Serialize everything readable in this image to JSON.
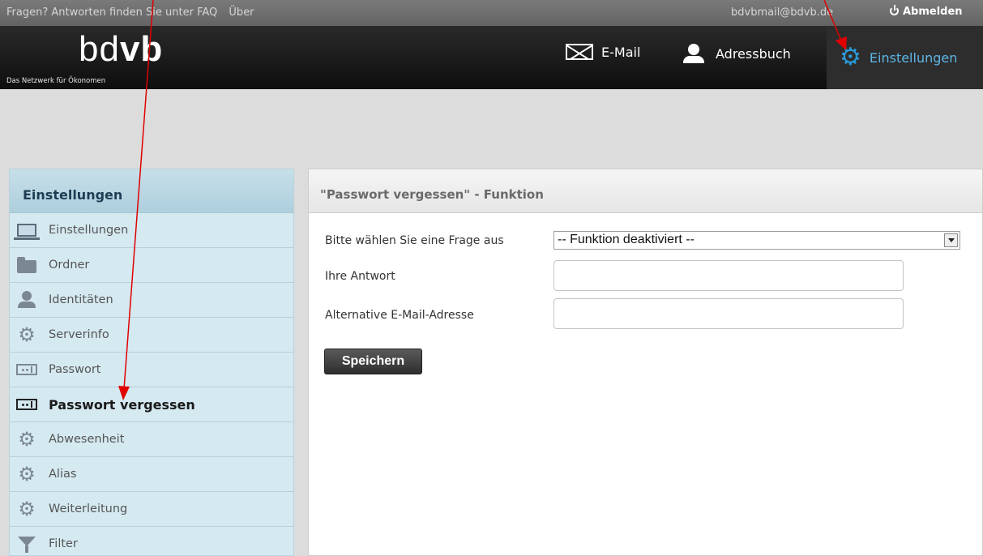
{
  "topbar": {
    "faq_text": "Fragen? Antworten finden Sie unter FAQ",
    "about": "Über",
    "user_email": "bdvbmail@bdvb.de",
    "logout": "Abmelden"
  },
  "header": {
    "logo_thin": "bd",
    "logo_bold": "vb",
    "tagline": "Das Netzwerk für Ökonomen",
    "nav": {
      "email": "E-Mail",
      "addressbook": "Adressbuch",
      "settings": "Einstellungen"
    }
  },
  "sidebar": {
    "title": "Einstellungen",
    "items": [
      {
        "label": "Einstellungen",
        "icon": "laptop-icon"
      },
      {
        "label": "Ordner",
        "icon": "folder-icon"
      },
      {
        "label": "Identitäten",
        "icon": "user-icon"
      },
      {
        "label": "Serverinfo",
        "icon": "gear-icon"
      },
      {
        "label": "Passwort",
        "icon": "password-icon"
      },
      {
        "label": "Passwort vergessen",
        "icon": "password-icon",
        "active": true
      },
      {
        "label": "Abwesenheit",
        "icon": "gear-icon"
      },
      {
        "label": "Alias",
        "icon": "gear-icon"
      },
      {
        "label": "Weiterleitung",
        "icon": "gear-icon"
      },
      {
        "label": "Filter",
        "icon": "filter-icon"
      }
    ]
  },
  "panel": {
    "title": "\"Passwort vergessen\" - Funktion",
    "question_label": "Bitte wählen Sie eine Frage aus",
    "question_value": "-- Funktion deaktiviert --",
    "answer_label": "Ihre Antwort",
    "answer_value": "",
    "alt_email_label": "Alternative E-Mail-Adresse",
    "alt_email_value": "",
    "save": "Speichern"
  },
  "colors": {
    "accent": "#2a9ad8",
    "annotation": "#e00000",
    "sidebar_bg": "#d5e9f1"
  }
}
